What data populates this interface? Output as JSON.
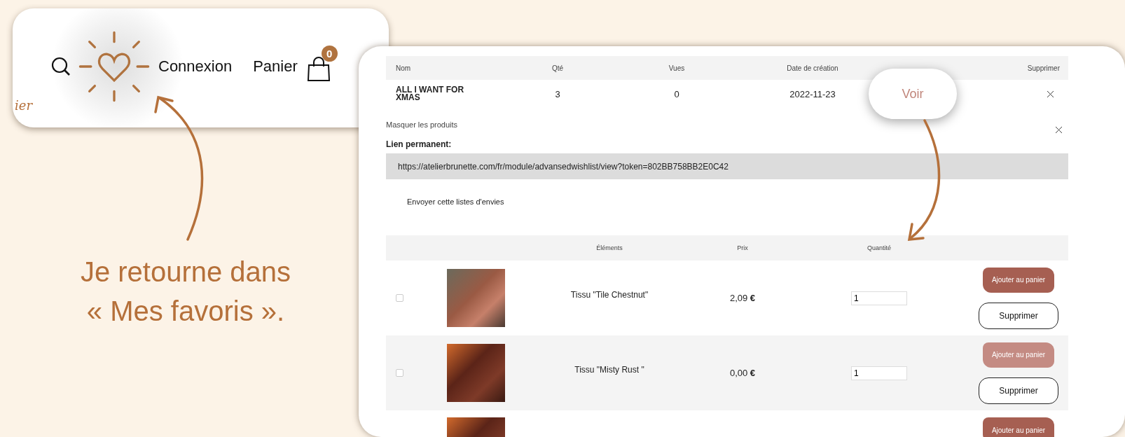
{
  "header_card": {
    "logo_fragment": "ier",
    "login": "Connexion",
    "cart_label": "Panier",
    "cart_count": "0",
    "favorites_highlighted": true
  },
  "caption": {
    "lines": [
      "Je retourne dans",
      "« Mes favoris »."
    ]
  },
  "wishlists": {
    "columns": [
      "Nom",
      "Qté",
      "Vues",
      "Date de création",
      "Supprimer"
    ],
    "rows": [
      {
        "name": "ALL I WANT FOR XMAS",
        "qty": "3",
        "views": "0",
        "date": "2022-11-23"
      }
    ],
    "view_callout": "Voir"
  },
  "details": {
    "hide_products": "Masquer les produits",
    "permalink_label": "Lien permanent:",
    "permalink_url": "https://atelierbrunette.com/fr/module/advansedwishlist/view?token=802BB758BB2E0C42",
    "send_link": "Envoyer cette listes d'envies"
  },
  "products": {
    "columns": [
      "Éléments",
      "Prix",
      "Quantité"
    ],
    "rows": [
      {
        "kind": "full",
        "checked": false,
        "name": "Tissu \"Tile Chestnut\"",
        "price": "2,09 **€**",
        "quantity": "1",
        "add_label": "Ajouter au panier",
        "add_disabled": false,
        "remove_label": "Supprimer"
      },
      {
        "kind": "full",
        "checked": false,
        "name": "Tissu \"Misty Rust \"",
        "price": "0,00 **€**",
        "quantity": "1",
        "add_label": "Ajouter au panier",
        "add_disabled": true,
        "remove_label": "Supprimer"
      },
      {
        "kind": "partial",
        "add_label": "Ajouter au panier",
        "add_disabled": false
      }
    ]
  }
}
